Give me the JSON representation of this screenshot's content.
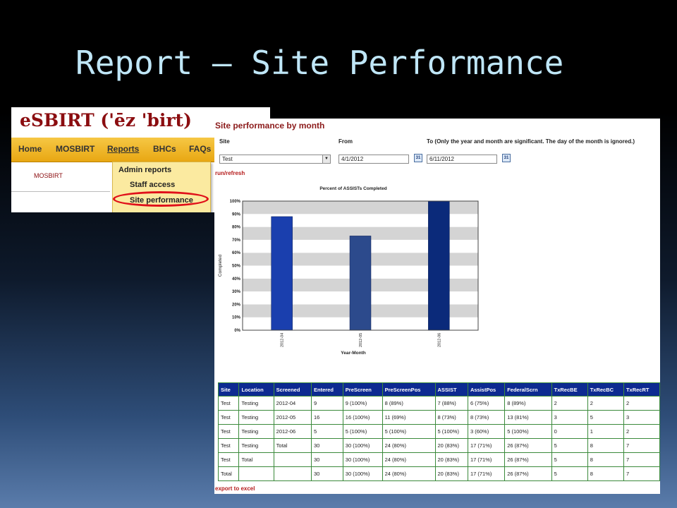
{
  "slide": {
    "title": "Report – Site Performance"
  },
  "nav": {
    "brand": "eSBIRT ('ēz 'birt)",
    "menu": [
      "Home",
      "MOSBIRT",
      "Reports",
      "BHCs",
      "FAQs"
    ],
    "subnav": "MOSBIRT",
    "dropdown": [
      "Admin reports",
      "Staff access",
      "Site performance"
    ]
  },
  "report": {
    "title": "Site performance by month",
    "site_label": "Site",
    "from_label": "From",
    "to_label": "To (Only the year and month are significant. The day of the month is ignored.)",
    "site_value": "Test",
    "from_value": "4/1/2012",
    "to_value": "6/11/2012",
    "cal_icon": "31",
    "run_link": "run/refresh",
    "export_link": "export to excel",
    "table": {
      "headers": [
        "Site",
        "Location",
        "Screened",
        "Entered",
        "PreScreen",
        "PreScreenPos",
        "ASSIST",
        "AssistPos",
        "FederalScrn",
        "TxRecBE",
        "TxRecBC",
        "TxRecRT"
      ],
      "rows": [
        [
          "Test",
          "Testing",
          "2012-04",
          "9",
          "9 (100%)",
          "8 (89%)",
          "7 (88%)",
          "6 (75%)",
          "8 (89%)",
          "2",
          "2",
          "2"
        ],
        [
          "Test",
          "Testing",
          "2012-05",
          "16",
          "16 (100%)",
          "11 (69%)",
          "8 (73%)",
          "8 (73%)",
          "13 (81%)",
          "3",
          "5",
          "3"
        ],
        [
          "Test",
          "Testing",
          "2012-06",
          "5",
          "5 (100%)",
          "5 (100%)",
          "5 (100%)",
          "3 (60%)",
          "5 (100%)",
          "0",
          "1",
          "2"
        ],
        [
          "Test",
          "Testing",
          "Total",
          "30",
          "30 (100%)",
          "24 (80%)",
          "20 (83%)",
          "17 (71%)",
          "26 (87%)",
          "5",
          "8",
          "7"
        ],
        [
          "Test",
          "Total",
          "",
          "30",
          "30 (100%)",
          "24 (80%)",
          "20 (83%)",
          "17 (71%)",
          "26 (87%)",
          "5",
          "8",
          "7"
        ],
        [
          "Total",
          "",
          "",
          "30",
          "30 (100%)",
          "24 (80%)",
          "20 (83%)",
          "17 (71%)",
          "26 (87%)",
          "5",
          "8",
          "7"
        ]
      ]
    }
  },
  "chart_data": {
    "type": "bar",
    "title": "Percent of ASSISTs Completed",
    "xlabel": "Year-Month",
    "ylabel": "Completed",
    "categories": [
      "2012-04",
      "2012-05",
      "2012-06"
    ],
    "values": [
      88,
      73,
      100
    ],
    "ylim": [
      0,
      100
    ],
    "yticks": [
      "0%",
      "10%",
      "20%",
      "30%",
      "40%",
      "50%",
      "60%",
      "70%",
      "80%",
      "90%",
      "100%"
    ],
    "colors": [
      "#1a3fae",
      "#2c4a8c",
      "#0b2a7a"
    ],
    "grid": "alternating horizontal bands"
  }
}
